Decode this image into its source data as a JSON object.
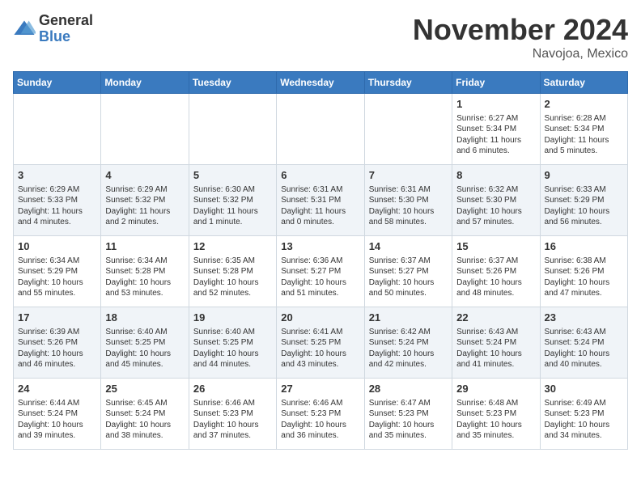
{
  "header": {
    "logo_general": "General",
    "logo_blue": "Blue",
    "month_title": "November 2024",
    "location": "Navojoa, Mexico"
  },
  "weekdays": [
    "Sunday",
    "Monday",
    "Tuesday",
    "Wednesday",
    "Thursday",
    "Friday",
    "Saturday"
  ],
  "weeks": [
    [
      {
        "day": "",
        "info": ""
      },
      {
        "day": "",
        "info": ""
      },
      {
        "day": "",
        "info": ""
      },
      {
        "day": "",
        "info": ""
      },
      {
        "day": "",
        "info": ""
      },
      {
        "day": "1",
        "info": "Sunrise: 6:27 AM\nSunset: 5:34 PM\nDaylight: 11 hours and 6 minutes."
      },
      {
        "day": "2",
        "info": "Sunrise: 6:28 AM\nSunset: 5:34 PM\nDaylight: 11 hours and 5 minutes."
      }
    ],
    [
      {
        "day": "3",
        "info": "Sunrise: 6:29 AM\nSunset: 5:33 PM\nDaylight: 11 hours and 4 minutes."
      },
      {
        "day": "4",
        "info": "Sunrise: 6:29 AM\nSunset: 5:32 PM\nDaylight: 11 hours and 2 minutes."
      },
      {
        "day": "5",
        "info": "Sunrise: 6:30 AM\nSunset: 5:32 PM\nDaylight: 11 hours and 1 minute."
      },
      {
        "day": "6",
        "info": "Sunrise: 6:31 AM\nSunset: 5:31 PM\nDaylight: 11 hours and 0 minutes."
      },
      {
        "day": "7",
        "info": "Sunrise: 6:31 AM\nSunset: 5:30 PM\nDaylight: 10 hours and 58 minutes."
      },
      {
        "day": "8",
        "info": "Sunrise: 6:32 AM\nSunset: 5:30 PM\nDaylight: 10 hours and 57 minutes."
      },
      {
        "day": "9",
        "info": "Sunrise: 6:33 AM\nSunset: 5:29 PM\nDaylight: 10 hours and 56 minutes."
      }
    ],
    [
      {
        "day": "10",
        "info": "Sunrise: 6:34 AM\nSunset: 5:29 PM\nDaylight: 10 hours and 55 minutes."
      },
      {
        "day": "11",
        "info": "Sunrise: 6:34 AM\nSunset: 5:28 PM\nDaylight: 10 hours and 53 minutes."
      },
      {
        "day": "12",
        "info": "Sunrise: 6:35 AM\nSunset: 5:28 PM\nDaylight: 10 hours and 52 minutes."
      },
      {
        "day": "13",
        "info": "Sunrise: 6:36 AM\nSunset: 5:27 PM\nDaylight: 10 hours and 51 minutes."
      },
      {
        "day": "14",
        "info": "Sunrise: 6:37 AM\nSunset: 5:27 PM\nDaylight: 10 hours and 50 minutes."
      },
      {
        "day": "15",
        "info": "Sunrise: 6:37 AM\nSunset: 5:26 PM\nDaylight: 10 hours and 48 minutes."
      },
      {
        "day": "16",
        "info": "Sunrise: 6:38 AM\nSunset: 5:26 PM\nDaylight: 10 hours and 47 minutes."
      }
    ],
    [
      {
        "day": "17",
        "info": "Sunrise: 6:39 AM\nSunset: 5:26 PM\nDaylight: 10 hours and 46 minutes."
      },
      {
        "day": "18",
        "info": "Sunrise: 6:40 AM\nSunset: 5:25 PM\nDaylight: 10 hours and 45 minutes."
      },
      {
        "day": "19",
        "info": "Sunrise: 6:40 AM\nSunset: 5:25 PM\nDaylight: 10 hours and 44 minutes."
      },
      {
        "day": "20",
        "info": "Sunrise: 6:41 AM\nSunset: 5:25 PM\nDaylight: 10 hours and 43 minutes."
      },
      {
        "day": "21",
        "info": "Sunrise: 6:42 AM\nSunset: 5:24 PM\nDaylight: 10 hours and 42 minutes."
      },
      {
        "day": "22",
        "info": "Sunrise: 6:43 AM\nSunset: 5:24 PM\nDaylight: 10 hours and 41 minutes."
      },
      {
        "day": "23",
        "info": "Sunrise: 6:43 AM\nSunset: 5:24 PM\nDaylight: 10 hours and 40 minutes."
      }
    ],
    [
      {
        "day": "24",
        "info": "Sunrise: 6:44 AM\nSunset: 5:24 PM\nDaylight: 10 hours and 39 minutes."
      },
      {
        "day": "25",
        "info": "Sunrise: 6:45 AM\nSunset: 5:24 PM\nDaylight: 10 hours and 38 minutes."
      },
      {
        "day": "26",
        "info": "Sunrise: 6:46 AM\nSunset: 5:23 PM\nDaylight: 10 hours and 37 minutes."
      },
      {
        "day": "27",
        "info": "Sunrise: 6:46 AM\nSunset: 5:23 PM\nDaylight: 10 hours and 36 minutes."
      },
      {
        "day": "28",
        "info": "Sunrise: 6:47 AM\nSunset: 5:23 PM\nDaylight: 10 hours and 35 minutes."
      },
      {
        "day": "29",
        "info": "Sunrise: 6:48 AM\nSunset: 5:23 PM\nDaylight: 10 hours and 35 minutes."
      },
      {
        "day": "30",
        "info": "Sunrise: 6:49 AM\nSunset: 5:23 PM\nDaylight: 10 hours and 34 minutes."
      }
    ]
  ]
}
